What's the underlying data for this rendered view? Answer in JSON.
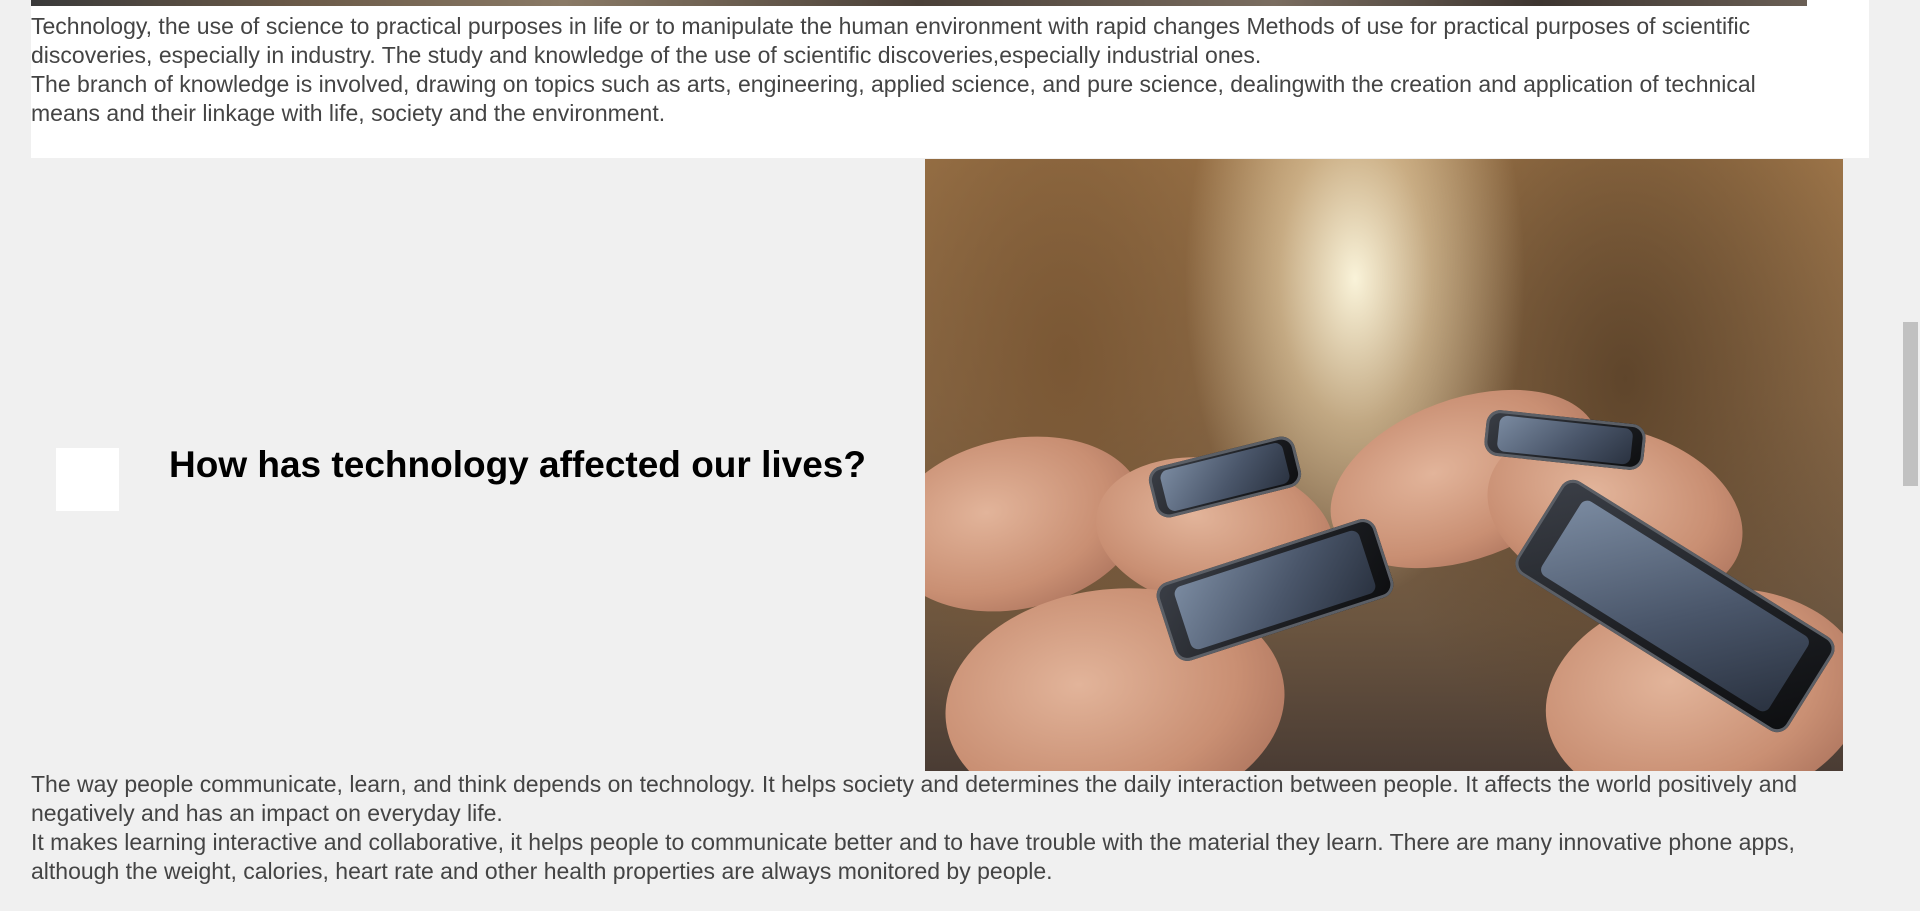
{
  "intro": {
    "paragraph_1": "Technology, the use of science to practical purposes in life or to manipulate the human environment with rapid changes Methods of use for practical purposes of scientific discoveries, especially in industry. The study and knowledge of the use of scientific discoveries,especially industrial ones.",
    "paragraph_2": "The branch of knowledge is involved, drawing on topics such as arts, engineering, applied science, and pure science, dealingwith the creation and application of technical means and their linkage with life, society and the environment."
  },
  "section": {
    "heading": "How has technology affected our lives?",
    "image_icon": "people-using-smartphones-photo"
  },
  "body": {
    "paragraph_1": "The way people communicate, learn, and think depends on technology. It helps society and determines the daily interaction between people. It affects the world positively and negatively and has an impact on everyday life.",
    "paragraph_2": "It makes learning interactive and collaborative, it helps people to communicate better and to have trouble with the material they learn. There are many innovative phone apps, although the weight, calories, heart rate and other health properties are always monitored by people."
  },
  "colors": {
    "page_background": "#f0f0f0",
    "card_background": "#ffffff",
    "body_text": "#444444",
    "heading_text": "#000000",
    "scrollbar_thumb": "#c1c1c1"
  }
}
